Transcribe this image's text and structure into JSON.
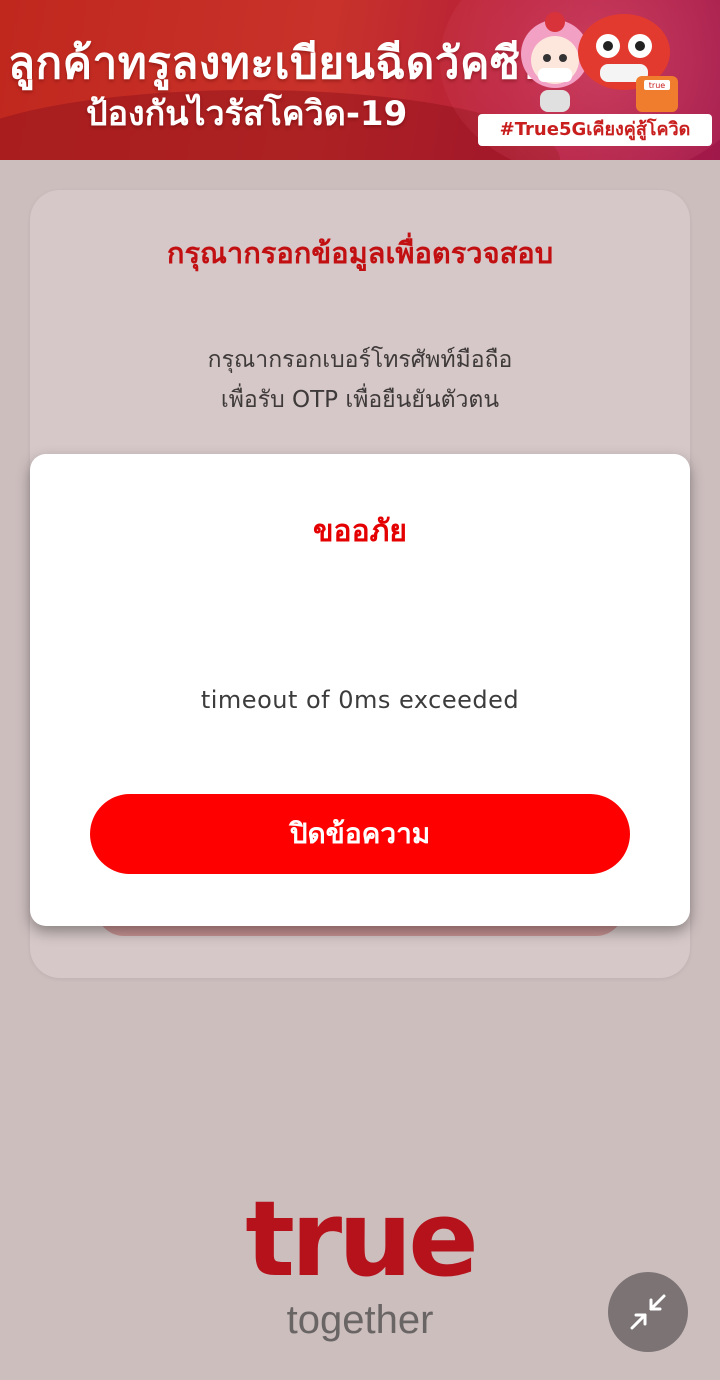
{
  "banner": {
    "line1": "ลูกค้าทรูลงทะเบียนฉีดวัคซีน",
    "line2": "ป้องกันไวรัสโควิด-19",
    "hashtag": "#True5Gเคียงคู่สู้โควิด",
    "mascot_badge": "true"
  },
  "card": {
    "title": "กรุณากรอกข้อมูลเพื่อตรวจสอบ",
    "instruction_line1": "กรุณากรอกเบอร์โทรศัพท์มือถือ",
    "instruction_line2": "เพื่อรับ OTP เพื่อยืนยันตัวตน"
  },
  "modal": {
    "title": "ขออภัย",
    "message": "timeout of 0ms exceeded",
    "close_label": "ปิดข้อความ"
  },
  "footer": {
    "logo_text": "true",
    "tagline": "together"
  },
  "fab": {
    "icon": "minimize-arrows-icon"
  },
  "colors": {
    "brand_red": "#e40000",
    "button_red": "#ff0000",
    "page_bg": "#cdbebe"
  }
}
